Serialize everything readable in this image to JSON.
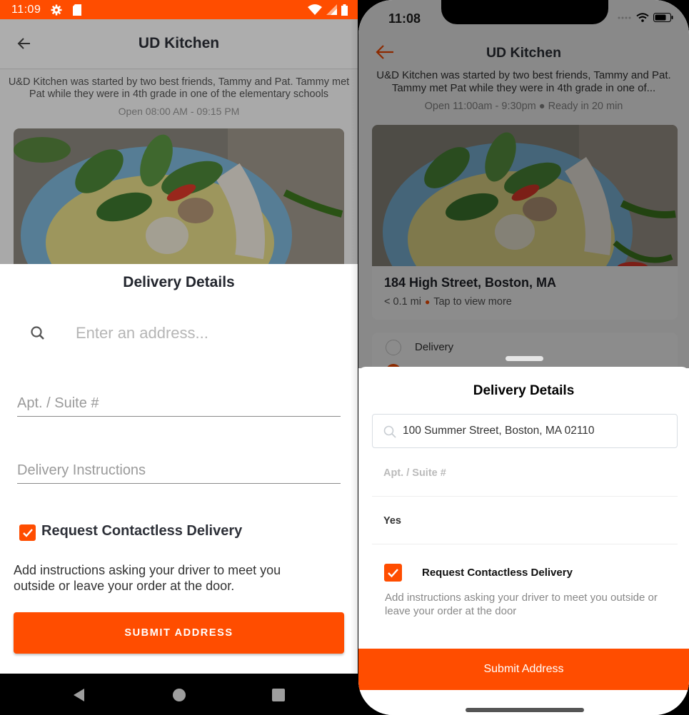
{
  "colors": {
    "accent": "#ff4d00",
    "text_dark": "#2d3038",
    "muted": "#999999"
  },
  "android": {
    "status_bar": {
      "time": "11:09",
      "icons": [
        "gear-icon",
        "sd-card-icon",
        "wifi-icon",
        "signal-icon",
        "battery-icon"
      ]
    },
    "header": {
      "title": "UD Kitchen",
      "back_icon": "arrow-left-icon"
    },
    "restaurant": {
      "description": "U&D Kitchen was started by two best friends, Tammy and Pat.   Tammy met Pat while they were in 4th grade in one of the elementary schools",
      "hours": "Open 08:00 AM - 09:15 PM",
      "photo": "green-curry-bowl"
    },
    "sheet": {
      "title": "Delivery Details",
      "search": {
        "placeholder": "Enter an address...",
        "value": ""
      },
      "apt": {
        "placeholder": "Apt. / Suite #",
        "value": ""
      },
      "instructions": {
        "placeholder": "Delivery Instructions",
        "value": ""
      },
      "contactless": {
        "label": "Request Contactless Delivery",
        "checked": true
      },
      "help_text": "Add instructions asking your driver to meet you outside or leave your order at the door.",
      "submit_label": "SUBMIT ADDRESS"
    },
    "nav_bar": {
      "buttons": [
        "back-triangle",
        "home-circle",
        "recents-square"
      ]
    }
  },
  "ios": {
    "status_bar": {
      "time": "11:08",
      "icons": [
        "signal-dots-icon",
        "wifi-icon",
        "battery-icon"
      ]
    },
    "header": {
      "title": "UD Kitchen",
      "back_icon": "arrow-left-icon"
    },
    "restaurant": {
      "description": "U&D Kitchen was started by two best friends, Tammy and Pat.   Tammy met Pat while they were in 4th grade in one of...",
      "hours": "Open 11:00am - 9:30pm",
      "ready": "Ready in 20 min",
      "address": "184 High Street, Boston, MA",
      "distance": "< 0.1 mi",
      "view_more": "Tap to view more"
    },
    "fulfillment": {
      "option_delivery": "Delivery"
    },
    "sheet": {
      "title": "Delivery Details",
      "search": {
        "value": "100 Summer Street, Boston, MA 02110"
      },
      "apt": {
        "placeholder": "Apt. / Suite #",
        "value": ""
      },
      "instructions": {
        "value": "Yes"
      },
      "contactless": {
        "label": "Request Contactless Delivery",
        "checked": true
      },
      "help_text": "Add instructions asking your driver to meet you outside or leave your order at the door",
      "submit_label": "Submit Address"
    }
  }
}
